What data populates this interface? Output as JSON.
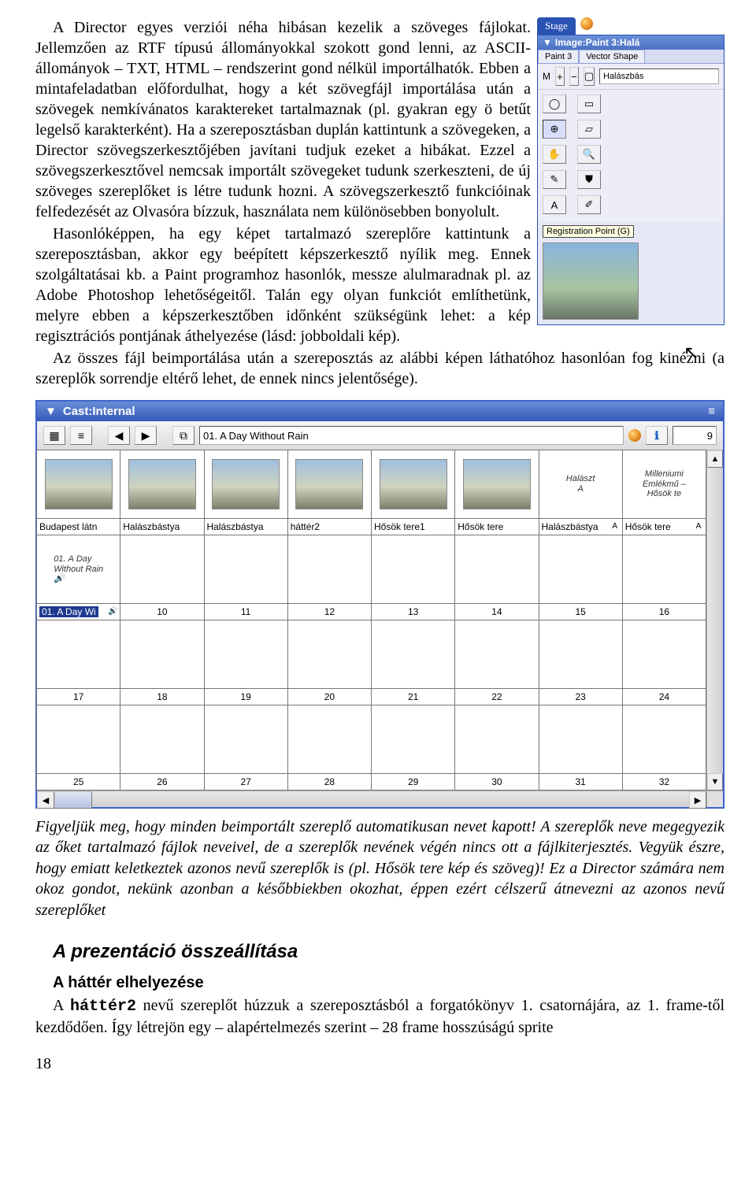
{
  "paragraphs": {
    "p1": "A Director egyes verziói néha hibásan kezelik a szöveges fájlokat. Jellemzően az RTF típusú állományokkal szokott gond lenni, az ASCII-állományok – TXT, HTML – rendszerint gond nélkül importálhatók. Ebben a mintafeladatban előfordulhat, hogy a két szövegfájl importálása után a szövegek nemkívánatos karaktereket tartalmaznak (pl. gyakran egy ö betűt legelső karakterként). Ha a szereposztásban duplán kattintunk a szövegeken, a Director szövegszerkesztőjében javítani tudjuk ezeket a hibákat. Ezzel a szövegszerkesztővel nemcsak importált szövegeket tudunk szerkeszteni, de új szöveges szereplőket is létre tudunk hozni. A szövegszerkesztő funkcióinak felfedezését az Olvasóra bízzuk, használata nem különösebben bonyolult.",
    "p2": "Hasonlóképpen, ha egy képet tartalmazó szereplőre kattintunk a szereposztásban, akkor egy beépített képszerkesztő nyílik meg. Ennek szolgáltatásai kb. a Paint programhoz hasonlók, messze alulmaradnak pl. az Adobe Photoshop lehetőségeitől. Talán egy olyan funkciót említhetünk, melyre ebben a képszerkesztőben időnként szükségünk lehet: a kép regisztrációs pontjának áthelyezése (lásd: jobboldali kép).",
    "p3": "Az összes fájl beimportálása után a szereposztás az alábbi képen láthatóhoz hasonlóan fog kinézni (a szereplők sorrendje eltérő lehet, de ennek nincs jelentősége)."
  },
  "inspector": {
    "stage_tab": "Stage",
    "title": "Image:Paint 3:Halá",
    "tab1": "Paint 3",
    "tab2": "Vector Shape",
    "tool_m_label": "M",
    "tool_field": "Halászbás",
    "tooltip": "Registration Point (G)"
  },
  "cast": {
    "title": "Cast:Internal",
    "name_value": "01. A Day Without Rain",
    "index_value": "9",
    "toolbar_glyphs": {
      "view1": "▦",
      "view2": "≡",
      "prev": "◀",
      "next": "▶",
      "drag": "⧉",
      "info": "ℹ"
    },
    "cells": [
      {
        "label": "Budapest látn",
        "type": "img"
      },
      {
        "label": "Halászbástya",
        "type": "img"
      },
      {
        "label": "Halászbástya",
        "type": "img"
      },
      {
        "label": "háttér2",
        "type": "img"
      },
      {
        "label": "Hősök tere1",
        "type": "img"
      },
      {
        "label": "Hősök tere",
        "type": "img"
      },
      {
        "label": "Halászbástya",
        "type": "text",
        "text": "Halászt\nA"
      },
      {
        "label": "Hősök tere",
        "type": "text",
        "text": "Milleniumi\nEmlékmű –\nHősök te"
      }
    ],
    "row2_first_text": "01. A Day Without Rain",
    "row2_selected_label": "01. A Day Wi",
    "row2_numbers": [
      "10",
      "11",
      "12",
      "13",
      "14",
      "15",
      "16"
    ],
    "row3_numbers": [
      "17",
      "18",
      "19",
      "20",
      "21",
      "22",
      "23",
      "24"
    ],
    "row4_numbers": [
      "25",
      "26",
      "27",
      "28",
      "29",
      "30",
      "31",
      "32"
    ]
  },
  "italic_note": "Figyeljük meg, hogy minden beimportált szereplő automatikusan nevet kapott! A szereplők neve megegyezik az őket tartalmazó fájlok neveivel, de a szereplők nevének végén nincs ott a fájlkiterjesztés. Vegyük észre, hogy emiatt keletkeztek azonos nevű szereplők is (pl. Hősök tere kép és szöveg)! Ez a Director számára nem okoz gondot, nekünk azonban a későbbiekben okozhat, éppen ezért célszerű átnevezni az azonos nevű szereplőket",
  "section_heading": "A prezentáció összeállítása",
  "sub_heading": "A háttér elhelyezése",
  "last_para_a": "A ",
  "last_para_mono": "háttér2",
  "last_para_b": " nevű szereplőt húzzuk a szereposztásból a forgatókönyv 1. csatornájára, az 1. frame-től kezdődően. Így létrejön egy – alapértelmezés szerint – 28 frame hosszúságú sprite",
  "page_number": "18",
  "icons": {
    "arrow_down": "▼",
    "plus": "+",
    "minus": "−",
    "lasso": "◯",
    "marquee": "▭",
    "reg": "⊕",
    "erase": "▱",
    "hand": "✋",
    "zoom": "🔍",
    "eyedrop": "✎",
    "bucket": "⛊",
    "text_a": "A",
    "brush": "✐",
    "sound": "🔊",
    "cursor": "↖"
  }
}
